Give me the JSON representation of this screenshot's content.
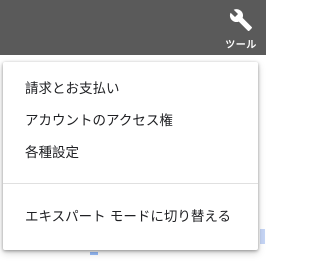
{
  "header": {
    "tools_label": "ツール",
    "tools_icon": "wrench-icon",
    "background_color": "#5a5a5a"
  },
  "menu": {
    "items": [
      {
        "label": "請求とお支払い"
      },
      {
        "label": "アカウントのアクセス権"
      },
      {
        "label": "各種設定"
      }
    ],
    "footer_item": {
      "label": "エキスパート モードに切り替える"
    }
  }
}
